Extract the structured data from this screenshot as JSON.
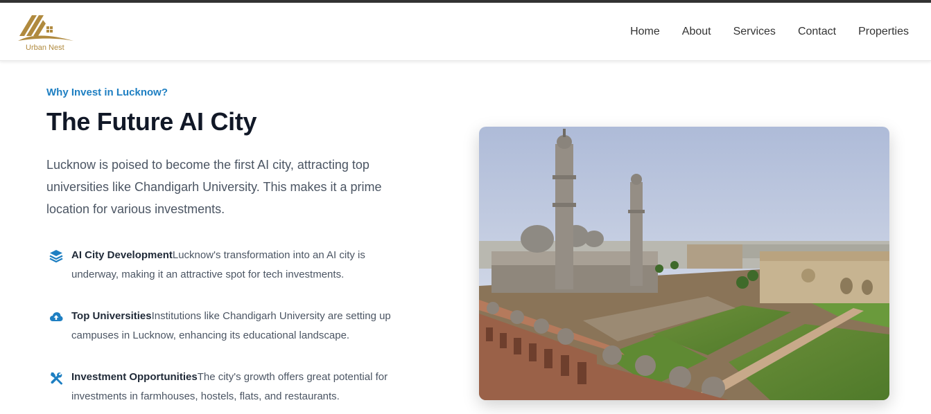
{
  "brand": {
    "name": "Urban Nest",
    "accent": "#b08a3e"
  },
  "nav": {
    "items": [
      "Home",
      "About",
      "Services",
      "Contact",
      "Properties"
    ]
  },
  "hero": {
    "kicker": "Why Invest in Lucknow?",
    "title": "The Future AI City",
    "lead": "Lucknow is poised to become the first AI city, attracting top universities like Chandigarh University. This makes it a prime location for various investments."
  },
  "features": [
    {
      "icon": "layers-icon",
      "title": "AI City Development",
      "text": "Lucknow's transformation into an AI city is underway, making it an attractive spot for tech investments."
    },
    {
      "icon": "cloud-upload-icon",
      "title": "Top Universities",
      "text": "Institutions like Chandigarh University are setting up campuses in Lucknow, enhancing its educational landscape."
    },
    {
      "icon": "tools-icon",
      "title": "Investment Opportunities",
      "text": "The city's growth offers great potential for investments in farmhouses, hostels, flats, and restaurants."
    }
  ],
  "colors": {
    "link": "#1e7fc2",
    "heading": "#111827",
    "body": "#4b5563"
  }
}
